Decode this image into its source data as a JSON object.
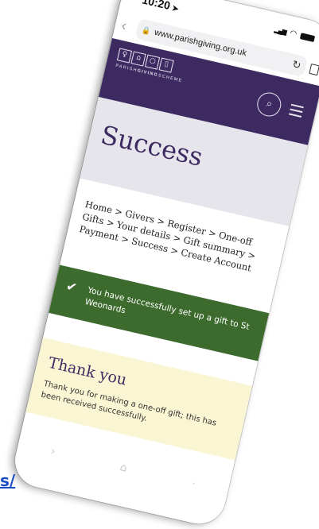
{
  "status_bar": {
    "time": "10:20"
  },
  "browser": {
    "url": "www.parishgiving.org.uk"
  },
  "site": {
    "logo_text_prefix": "PARISH",
    "logo_text_bold": "GIVING",
    "logo_text_suffix": "SCHEME"
  },
  "page": {
    "title": "Success"
  },
  "breadcrumb": {
    "items": [
      "Home",
      "Givers",
      "Register",
      "One-off Gifts",
      "Your details",
      "Gift summary",
      "Payment",
      "Success",
      "Create Account"
    ],
    "separator": ">"
  },
  "alert": {
    "message": "You have successfully set up a gift to St Weonards"
  },
  "thank_you": {
    "heading": "Thank you",
    "body": "Thank you for making a one-off gift; this has been received successfully."
  },
  "background_link_text": "s/",
  "colors": {
    "brand_purple": "#3d2a61",
    "success_green": "#3d6b2e",
    "panel_yellow": "#faf5d2",
    "link_blue": "#1a4fc4"
  }
}
